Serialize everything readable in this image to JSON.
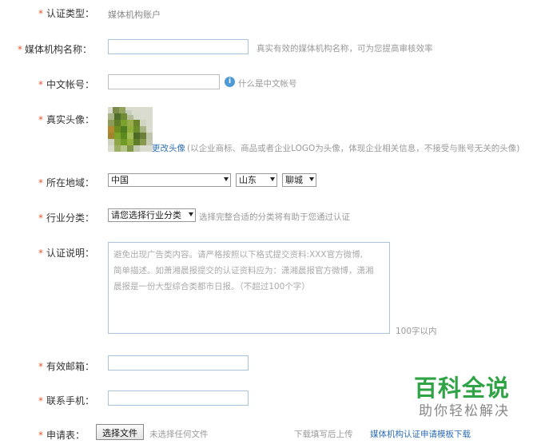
{
  "fields": {
    "cert_type": {
      "star": "*",
      "label": "认证类型：",
      "value": "媒体机构账户"
    },
    "org_name": {
      "star": "*",
      "label": "媒体机构名称：",
      "hint": "真实有效的媒体机构名称，可为您提高审核效率"
    },
    "chinese_account": {
      "star": "*",
      "label": "中文帐号：",
      "info_icon": "i",
      "hint": "什么是中文帐号"
    },
    "avatar": {
      "star": "*",
      "label": "真实头像：",
      "change_link": "更改头像",
      "hint": "(以企业商标、商品或者企业LOGO为头像，体现企业相关信息，不接受与账号无关的头像)"
    },
    "region": {
      "star": "*",
      "label": "所在地域：",
      "country": "中国",
      "province": "山东",
      "city": "聊城"
    },
    "industry": {
      "star": "*",
      "label": "行业分类：",
      "selected": "请您选择行业分类",
      "hint": "选择完整合适的分类将有助于您通过认证"
    },
    "description": {
      "star": "*",
      "label": "认证说明：",
      "placeholder_lines": [
        "避免出现广告类内容。请严格按照以下格式提交资料:XXX官方微博,",
        "简单描述。如萧湘晨报提交的认证资料应为：潇湘晨报官方微博，潇湘",
        "晨报是一份大型综合类都市日报。（不超过100个字）"
      ],
      "limit": "100字以内"
    },
    "email": {
      "star": "*",
      "label": "有效邮箱："
    },
    "phone": {
      "star": "*",
      "label": "联系手机："
    },
    "application": {
      "star": "*",
      "label": "申请表：",
      "file_button": "选择文件",
      "file_status": "未选择任何文件",
      "hint": "下载填写后上传",
      "template_link": "媒体机构认证申请模板下载"
    }
  },
  "watermark": {
    "title": "百科全说",
    "subtitle": "助你轻松解决"
  },
  "colors": {
    "required_star": "#e4572e",
    "link": "#2f6eb5",
    "input_border": "#a8c4dc",
    "info_icon": "#4d9ad6",
    "watermark_green": "#2fa346"
  }
}
